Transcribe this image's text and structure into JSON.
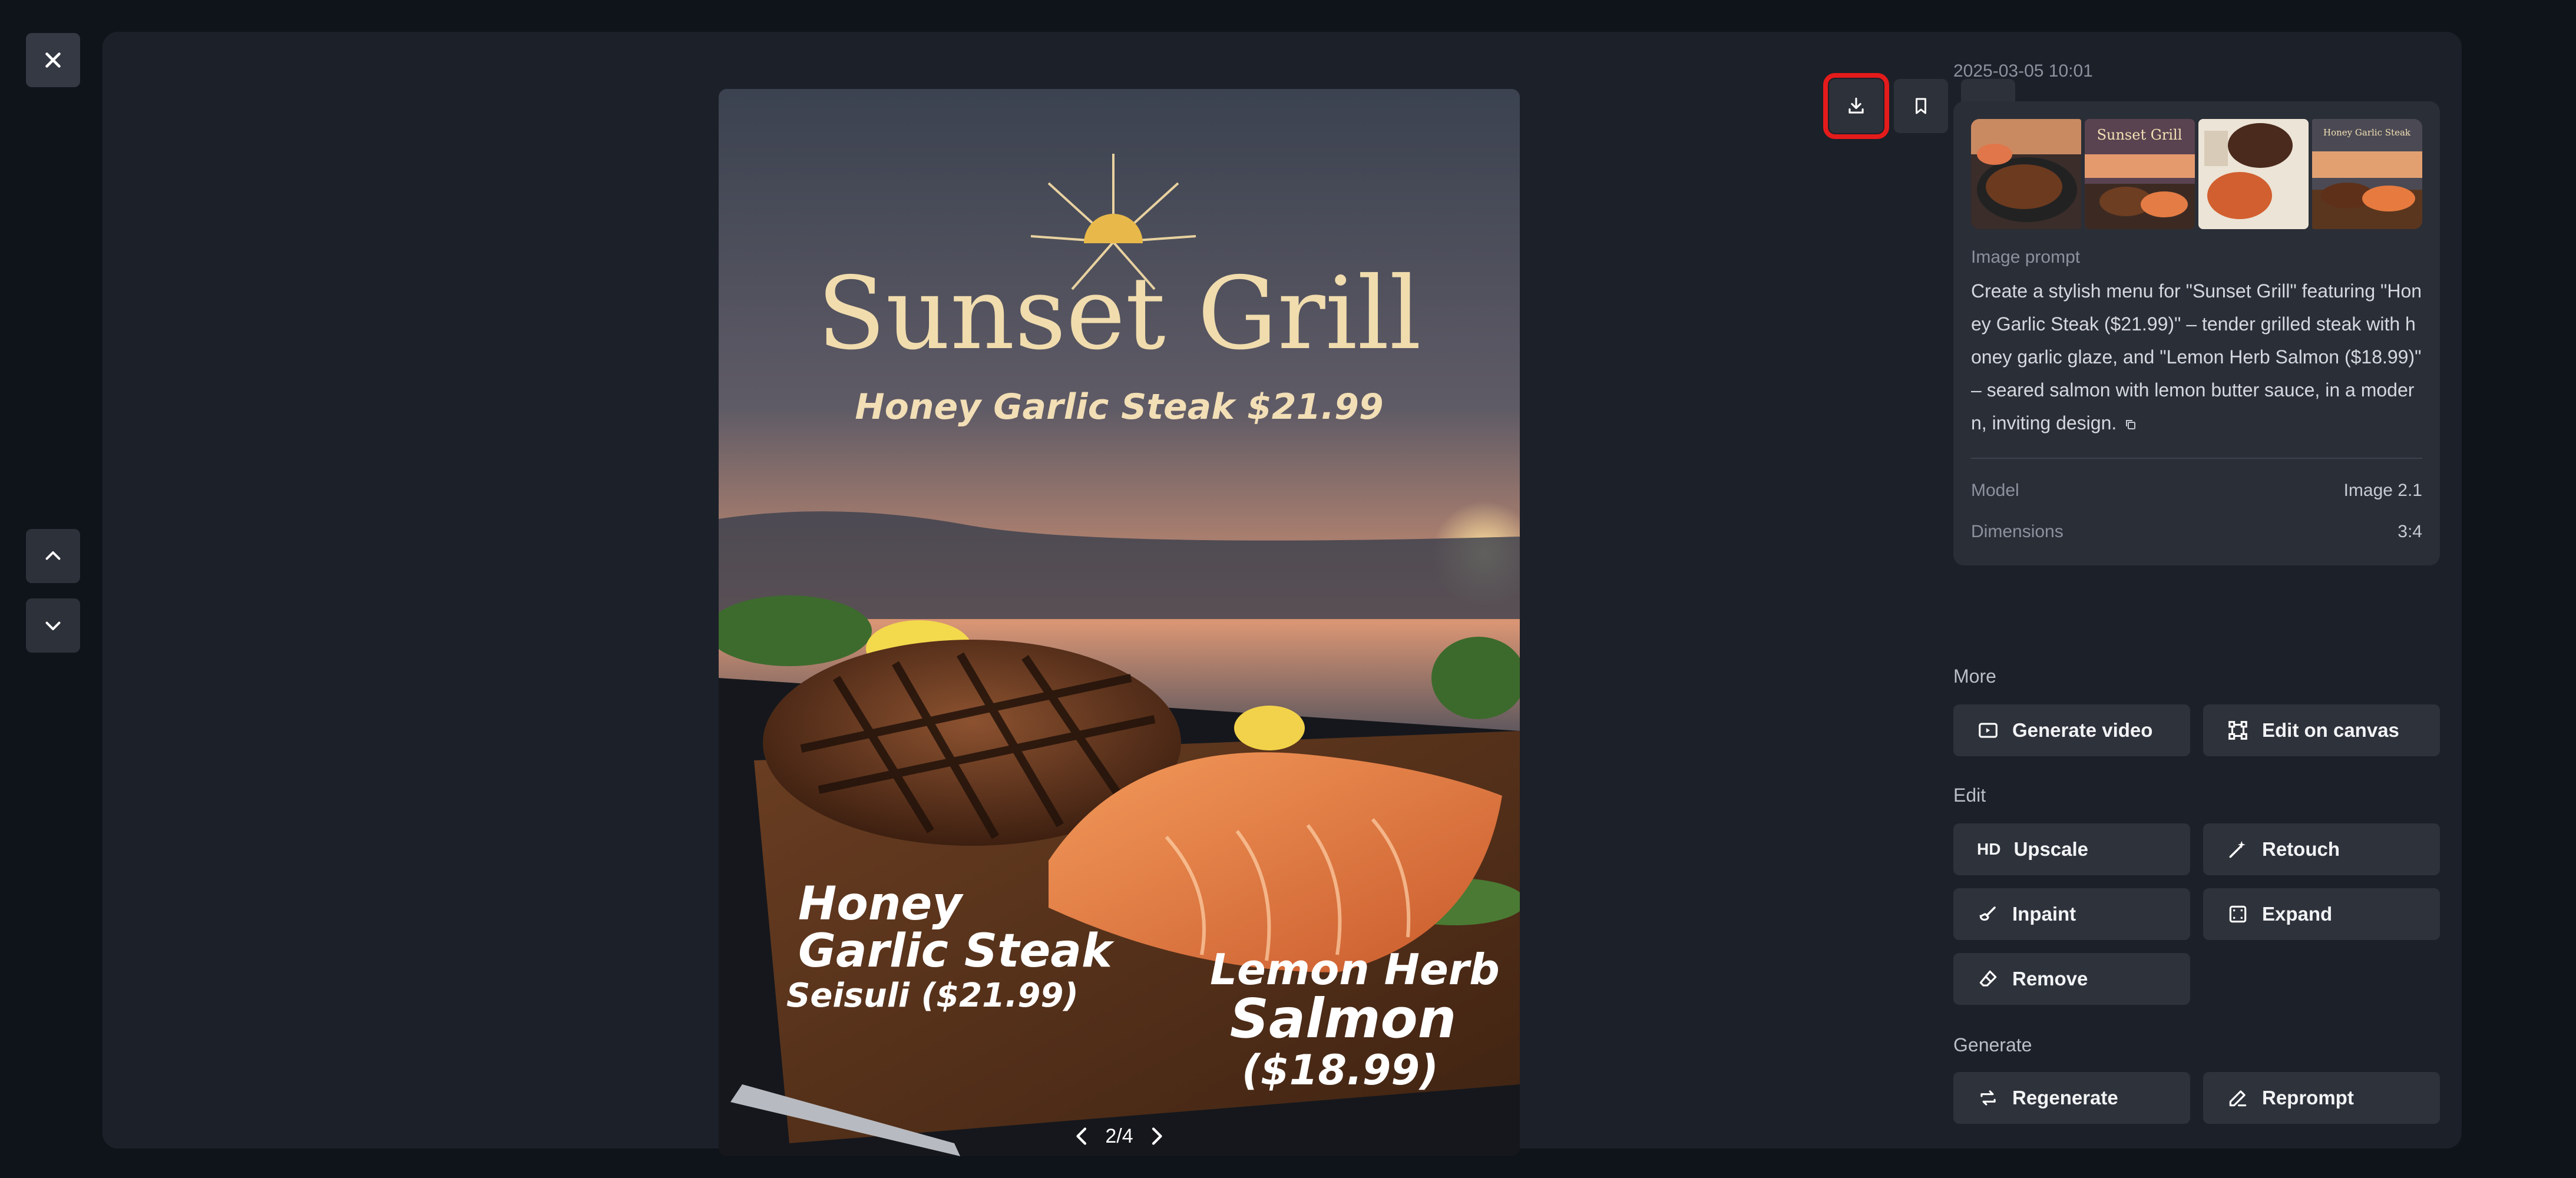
{
  "viewer": {
    "timestamp": "2025-03-05 10:01",
    "pager": "2/4"
  },
  "image": {
    "brand": "Sunset Grill",
    "headline": "Honey Garlic Steak $21.99",
    "steak_line1": "Honey",
    "steak_line2": "Garlic Steak",
    "steak_price": "Seisuli ($21.99)",
    "salmon_line1": "Lemon Herb",
    "salmon_line2": "Salmon",
    "salmon_price": "($18.99)"
  },
  "thumbnails": [
    {
      "title": ""
    },
    {
      "title": "Sunset Grill"
    },
    {
      "title": ""
    },
    {
      "title": "Honey Garlic Steak"
    }
  ],
  "prompt": {
    "label": "Image prompt",
    "text": "Create a stylish menu for \"Sunset Grill\" featuring \"Honey Garlic Steak ($21.99)\" – tender grilled steak with honey garlic glaze, and \"Lemon Herb Salmon ($18.99)\" – seared salmon with lemon butter sauce, in a modern, inviting design."
  },
  "meta": {
    "model_label": "Model",
    "model_value": "Image 2.1",
    "dimensions_label": "Dimensions",
    "dimensions_value": "3:4"
  },
  "sections": {
    "more": "More",
    "edit": "Edit",
    "generate": "Generate"
  },
  "actions": {
    "generate_video": "Generate video",
    "edit_on_canvas": "Edit on canvas",
    "upscale": "Upscale",
    "upscale_badge": "HD",
    "retouch": "Retouch",
    "inpaint": "Inpaint",
    "expand": "Expand",
    "remove": "Remove",
    "regenerate": "Regenerate",
    "reprompt": "Reprompt"
  },
  "colors": {
    "highlight": "#e41b1b",
    "panel": "#1c2029",
    "button": "#2e323b"
  },
  "icons": [
    "close-icon",
    "chevron-up-icon",
    "chevron-down-icon",
    "download-icon",
    "bookmark-icon",
    "more-icon",
    "copy-icon",
    "video-icon",
    "canvas-icon",
    "hd-icon",
    "retouch-icon",
    "inpaint-icon",
    "expand-icon",
    "eraser-icon",
    "regenerate-icon",
    "pen-icon",
    "chevron-left-icon",
    "chevron-right-icon"
  ]
}
